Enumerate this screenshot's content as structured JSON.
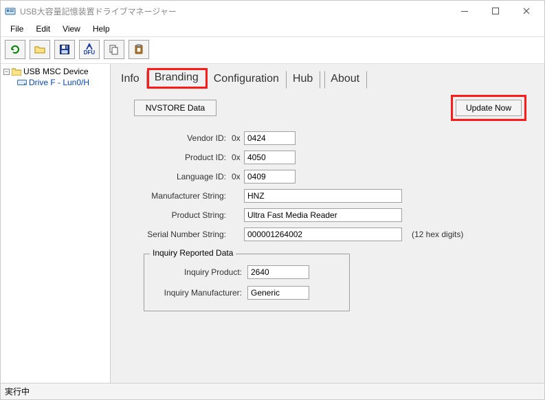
{
  "window": {
    "title": "USB大容量記憶装置ドライブマネージャー"
  },
  "menu": {
    "file": "File",
    "edit": "Edit",
    "view": "View",
    "help": "Help"
  },
  "toolbar": {
    "dfu_label": "DFU"
  },
  "tree": {
    "root": "USB MSC Device",
    "child": "Drive F - Lun0/H"
  },
  "tabs": {
    "info": "Info",
    "branding": "Branding",
    "configuration": "Configuration",
    "hub": "Hub",
    "about": "About"
  },
  "branding": {
    "nvstore_btn": "NVSTORE Data",
    "update_btn": "Update Now",
    "hex_prefix": "0x",
    "labels": {
      "vendor_id": "Vendor ID:",
      "product_id": "Product ID:",
      "language_id": "Language  ID:",
      "manufacturer_string": "Manufacturer String:",
      "product_string": "Product String:",
      "serial_number_string": "Serial Number String:",
      "serial_note": "(12 hex digits)",
      "inquiry_legend": "Inquiry Reported Data",
      "inquiry_product": "Inquiry Product:",
      "inquiry_manufacturer": "Inquiry Manufacturer:"
    },
    "fields": {
      "vendor_id": "0424",
      "product_id": "4050",
      "language_id": "0409",
      "manufacturer_string": "HNZ",
      "product_string": "Ultra Fast Media Reader",
      "serial_number_string": "000001264002",
      "inquiry_product": "2640",
      "inquiry_manufacturer": "Generic"
    }
  },
  "statusbar": {
    "text": "実行中"
  }
}
